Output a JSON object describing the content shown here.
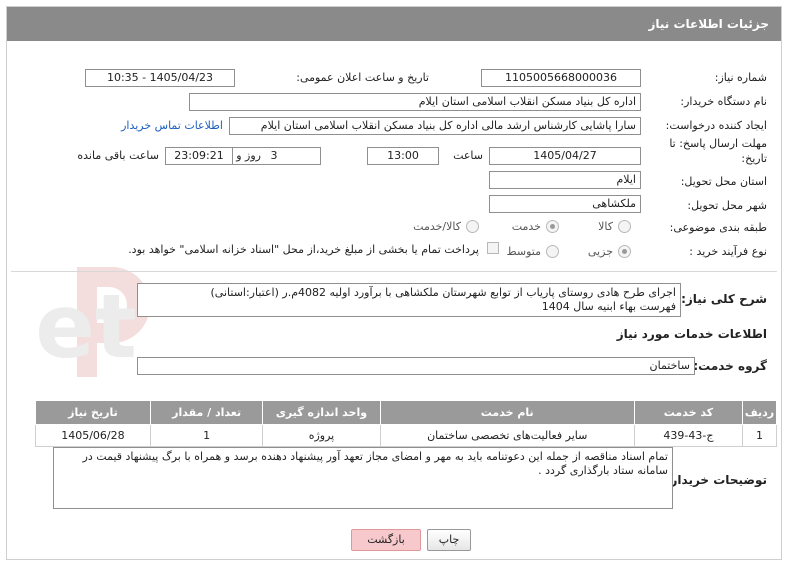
{
  "header": {
    "title": "جزئیات اطلاعات نیاز"
  },
  "form": {
    "need_number_label": "شماره نیاز:",
    "need_number": "1105005668000036",
    "announce_label": "تاریخ و ساعت اعلان عمومی:",
    "announce_value": "1405/04/23 - 10:35",
    "buyer_org_label": "نام دستگاه خریدار:",
    "buyer_org": "اداره کل بنیاد مسکن انقلاب اسلامی استان ایلام",
    "creator_label": "ایجاد کننده درخواست:",
    "creator": "سارا پاشایی کارشناس ارشد مالی اداره کل بنیاد مسکن انقلاب اسلامی استان ایلام",
    "contact_link": "اطلاعات تماس خریدار",
    "deadline_label_1": "مهلت ارسال پاسخ: تا",
    "deadline_label_2": "تاریخ:",
    "deadline_date": "1405/04/27",
    "time_label": "ساعت",
    "deadline_time": "13:00",
    "days_value": "3",
    "days_label": "روز و",
    "remaining_time": "23:09:21",
    "remaining_label": "ساعت باقی مانده",
    "province_label": "استان محل تحویل:",
    "province": "ایلام",
    "city_label": "شهر محل تحویل:",
    "city": "ملکشاهی",
    "category_label": "طبقه بندی موضوعی:",
    "category_options": [
      "کالا",
      "خدمت",
      "کالا/خدمت"
    ],
    "category_selected": 1,
    "process_label": "نوع فرآیند خرید :",
    "process_options": [
      "جزیی",
      "متوسط"
    ],
    "process_selected": 0,
    "payment_note": "پرداخت تمام یا بخشی از مبلغ خرید،از محل \"اسناد خزانه اسلامی\" خواهد بود."
  },
  "description": {
    "label": "شرح کلی نیاز:",
    "line1": "اجرای طرح هادی روستای پاریاب از توابع شهرستان ملکشاهی با برآورد اولیه 4082م.ر (اعتبار:استانی)",
    "line2": "فهرست بهاء ابنیه سال 1404"
  },
  "services": {
    "section_title": "اطلاعات خدمات مورد نیاز",
    "group_label": "گروه خدمت:",
    "group_value": "ساختمان",
    "columns": [
      "ردیف",
      "کد خدمت",
      "نام خدمت",
      "واحد اندازه گیری",
      "تعداد / مقدار",
      "تاریخ نیاز"
    ],
    "rows": [
      [
        "1",
        "ج-43-439",
        "سایر فعالیت‌های تخصصی ساختمان",
        "پروژه",
        "1",
        "1405/06/28"
      ]
    ]
  },
  "buyer_notes": {
    "label": "توضیحات خریدار:",
    "text": "تمام اسناد مناقصه از جمله این دعوتنامه باید به مهر و امضای مجاز تعهد آور پیشنهاد دهنده برسد و همراه با برگ پیشنهاد قیمت  در سامانه ستاد بارگذاری گردد ."
  },
  "buttons": {
    "print": "چاپ",
    "back": "بازگشت"
  },
  "watermark": {
    "text": "AriaTender.net"
  },
  "colors": {
    "header_bg": "#8a8a8a",
    "link": "#1f5fbf",
    "back_button": "#f7c9cc"
  }
}
